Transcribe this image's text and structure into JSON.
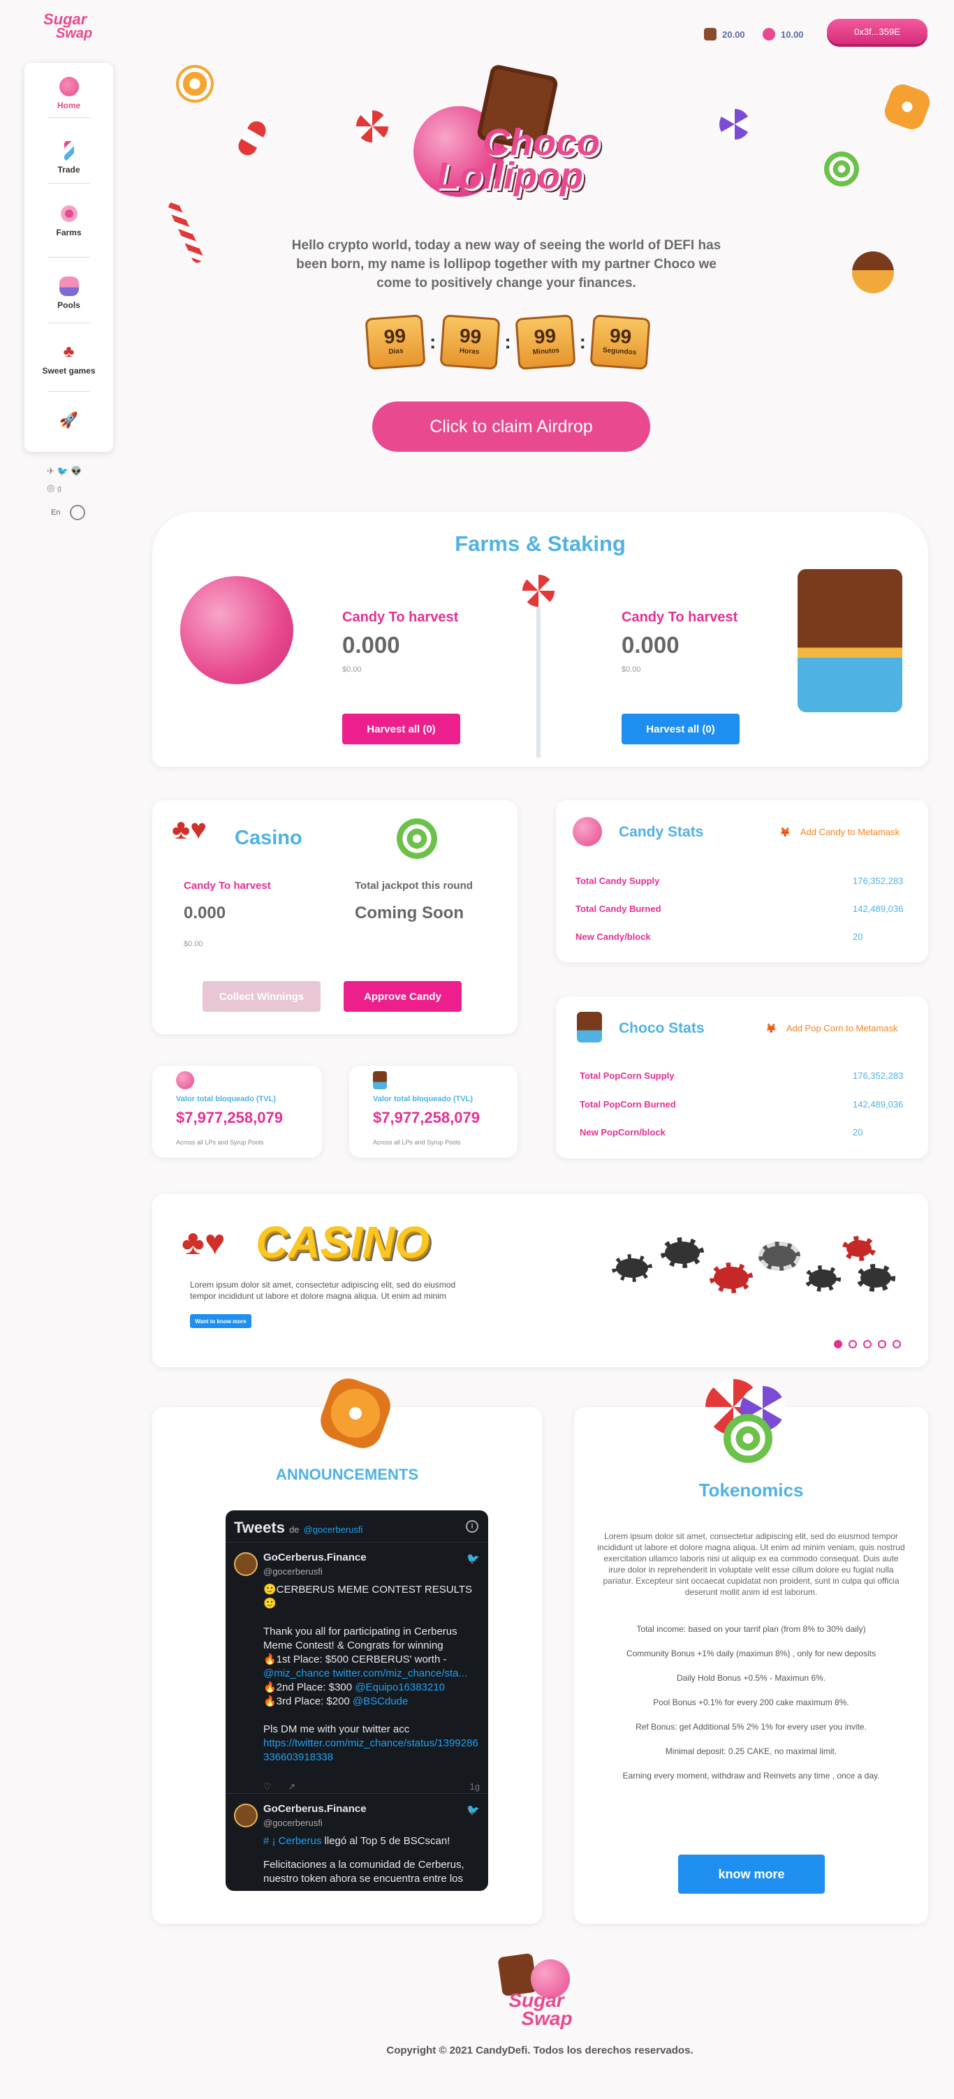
{
  "header": {
    "logo_line1": "Sugar",
    "logo_line2": "Swap",
    "stat1": "20.00",
    "stat2": "10.00",
    "wallet": "0x3f...359E"
  },
  "sidebar": {
    "items": [
      {
        "label": "Home"
      },
      {
        "label": "Trade"
      },
      {
        "label": "Farms"
      },
      {
        "label": "Pools"
      },
      {
        "label": "Sweet games"
      },
      {
        "label": ""
      }
    ],
    "social_row1": "✈ 🐦 👽",
    "social_row2": "◎ 𝔤",
    "lang": "En"
  },
  "hero": {
    "title_line1": "Choco",
    "title_line2": "Lollipop",
    "text": "Hello crypto world, today a new way of seeing the world of DEFI has been born, my name is lollipop together with my partner Choco we come to positively change your finances.",
    "countdown": [
      {
        "num": "99",
        "label": "Dias"
      },
      {
        "num": "99",
        "label": "Horas"
      },
      {
        "num": "99",
        "label": "Minutos"
      },
      {
        "num": "99",
        "label": "Segundos"
      }
    ],
    "airdrop_button": "Click to claim Airdrop"
  },
  "farms": {
    "title": "Farms & Staking",
    "left": {
      "label": "Candy To harvest",
      "value": "0.000",
      "usd": "$0.00",
      "button": "Harvest all (0)"
    },
    "right": {
      "label": "Candy To harvest",
      "value": "0.000",
      "usd": "$0.00",
      "button": "Harvest all (0)"
    }
  },
  "casino": {
    "title": "Casino",
    "harvest_label": "Candy To harvest",
    "harvest_value": "0.000",
    "harvest_usd": "$0.00",
    "jackpot_label": "Total jackpot this round",
    "jackpot_value": "Coming Soon",
    "collect_button": "Collect Winnings",
    "approve_button": "Approve Candy"
  },
  "candy_stats": {
    "title": "Candy Stats",
    "link": "Add Candy to Metamask",
    "rows": [
      {
        "label": "Total Candy Supply",
        "value": "176,352,283"
      },
      {
        "label": "Total Candy Burned",
        "value": "142,489,036"
      },
      {
        "label": "New Candy/block",
        "value": "20"
      }
    ]
  },
  "choco_stats": {
    "title": "Choco Stats",
    "link": "Add Pop Corn to Metamask",
    "rows": [
      {
        "label": "Total PopCorn Supply",
        "value": "176,352,283"
      },
      {
        "label": "Total PopCorn Burned",
        "value": "142,489,036"
      },
      {
        "label": "New PopCorn/block",
        "value": "20"
      }
    ]
  },
  "tvl": [
    {
      "label": "Valor total bloqueado (TVL)",
      "value": "$7,977,258,079",
      "note": "Across all LPs and Syrup Pools"
    },
    {
      "label": "Valor total bloqueado (TVL)",
      "value": "$7,977,258,079",
      "note": "Across all LPs and Syrup Pools"
    }
  ],
  "banner": {
    "logo_text": "CASINO",
    "text": "Lorem ipsum dolor sit amet, consectetur adipiscing elit, sed do eiusmod tempor incididunt ut labore et dolore magna aliqua. Ut enim ad minim",
    "button": "Want to know more"
  },
  "announcements": {
    "title": "ANNOUNCEMENTS",
    "widget_title": "Tweets",
    "widget_de": "de",
    "widget_handle": "@gocerberusfi",
    "tweets": [
      {
        "name": "GoCerberus.Finance",
        "handle": "@gocerberusfi",
        "text": "🙂CERBERUS MEME CONTEST RESULTS 🙂\n\nThank you all for participating in Cerberus Meme Contest! & Congrats for winning\n🔥1st Place: $500 CERBERUS' worth -",
        "link1": "@miz_chance twitter.com/miz_chance/sta...",
        "p2": "🔥2nd Place: $300",
        "link2": "@Equipo16383210",
        "p3": "🔥3rd Place: $200",
        "link3": "@BSCdude",
        "text2": "Pls DM me with your twitter acc",
        "link4": "https://twitter.com/miz_chance/status/1399286336603918338",
        "time": "1g"
      },
      {
        "name": "GoCerberus.Finance",
        "handle": "@gocerberusfi",
        "link": "# ¡ Cerberus",
        "text": "llegó al Top 5 de BSCscan!",
        "text2": "Felicitaciones a la comunidad de Cerberus, nuestro token ahora se encuentra entre los"
      }
    ]
  },
  "tokenomics": {
    "title": "Tokenomics",
    "intro": "Lorem ipsum dolor sit amet, consectetur adipiscing elit, sed do eiusmod tempor incididunt ut labore et dolore magna aliqua. Ut enim ad minim veniam, quis nostrud exercitation ullamco laboris nisi ut aliquip ex ea commodo consequat. Duis aute irure dolor in reprehenderit in voluptate velit esse cillum dolore eu fugiat nulla pariatur. Excepteur sint occaecat cupidatat non proident, sunt in culpa qui officia deserunt mollit anim id est laborum.",
    "lines": [
      "Total income: based on your tarrif plan (from 8% to 30% daily)",
      "Community Bonus +1% daily (maximun 8%) , only for new deposits",
      "Daily Hold Bonus +0.5% - Maximun 6%.",
      "Pool Bonus +0.1% for every 200 cake maximum 8%.",
      "Ref Bonus: get Additional 5% 2% 1% for every user you invite.",
      "Minimal deposit: 0.25 CAKE, no maximal limit.",
      "Earning every moment, withdraw and Reinvets any time , once a day."
    ],
    "button": "know more"
  },
  "footer": {
    "logo_line1": "Sugar",
    "logo_line2": "Swap",
    "copyright": "Copyright © 2021 CandyDefi. Todos los derechos reservados."
  }
}
